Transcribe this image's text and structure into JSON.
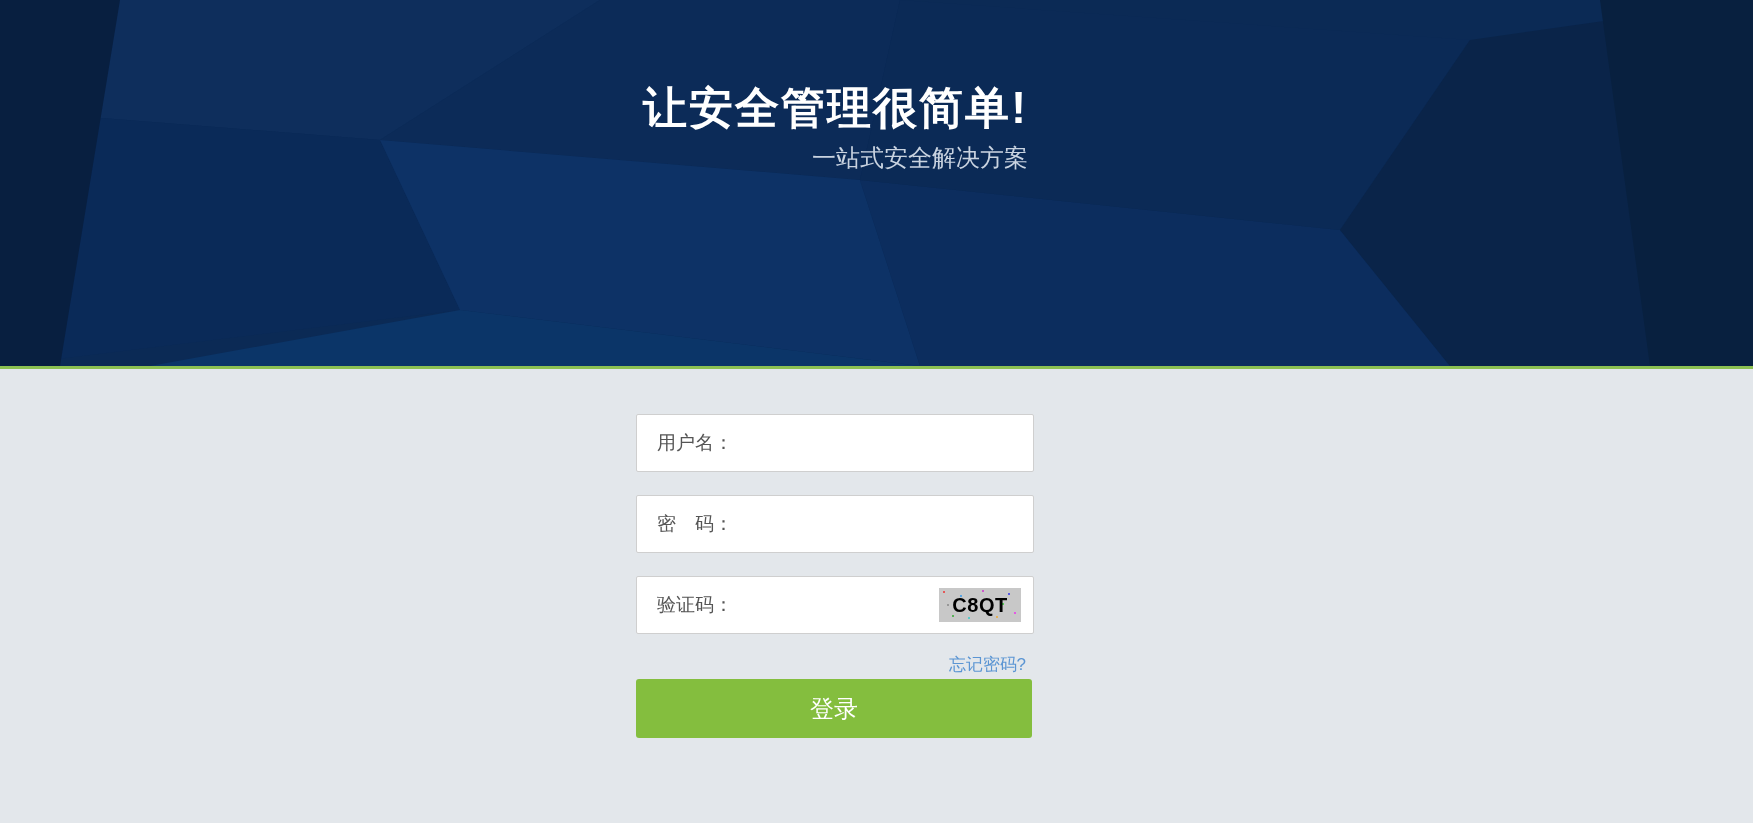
{
  "banner": {
    "title": "让安全管理很简单!",
    "subtitle": "一站式安全解决方案"
  },
  "login_form": {
    "fields": [
      {
        "kind": "text",
        "label": "用户名："
      },
      {
        "kind": "password",
        "label": "密　码："
      },
      {
        "kind": "captcha",
        "label": "验证码：",
        "captcha_text": "C8QT"
      }
    ],
    "forgot_link": "忘记密码?",
    "submit_button": "登录"
  }
}
